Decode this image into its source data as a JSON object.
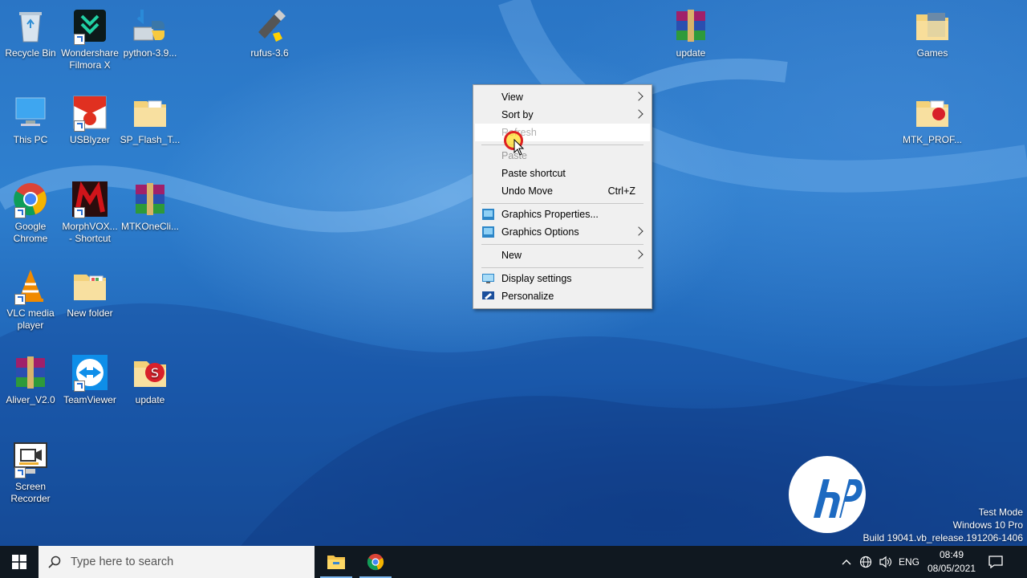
{
  "desktop_icons": [
    {
      "id": "recycle-bin",
      "label": "Recycle Bin"
    },
    {
      "id": "filmora",
      "label": "Wondershare Filmora X"
    },
    {
      "id": "python",
      "label": "python-3.9..."
    },
    {
      "id": "rufus",
      "label": "rufus-3.6"
    },
    {
      "id": "update-rar",
      "label": "update"
    },
    {
      "id": "games",
      "label": "Games"
    },
    {
      "id": "this-pc",
      "label": "This PC"
    },
    {
      "id": "usblyzer",
      "label": "USBlyzer"
    },
    {
      "id": "sp-flash",
      "label": "SP_Flash_T..."
    },
    {
      "id": "mtk-prof",
      "label": "MTK_PROF..."
    },
    {
      "id": "chrome",
      "label": "Google Chrome"
    },
    {
      "id": "morphvox",
      "label": "MorphVOX... - Shortcut"
    },
    {
      "id": "mtkonecli",
      "label": "MTKOneCli..."
    },
    {
      "id": "vlc",
      "label": "VLC media player"
    },
    {
      "id": "new-folder",
      "label": "New folder"
    },
    {
      "id": "aliver",
      "label": "Aliver_V2.0"
    },
    {
      "id": "teamviewer",
      "label": "TeamViewer"
    },
    {
      "id": "update-file",
      "label": "update"
    },
    {
      "id": "screen-recorder",
      "label": "Screen Recorder"
    }
  ],
  "context_menu": {
    "view": "View",
    "sort_by": "Sort by",
    "refresh": "Refresh",
    "paste": "Paste",
    "paste_shortcut": "Paste shortcut",
    "undo_move": "Undo Move",
    "undo_shortcut": "Ctrl+Z",
    "graphics_properties": "Graphics Properties...",
    "graphics_options": "Graphics Options",
    "new": "New",
    "display_settings": "Display settings",
    "personalize": "Personalize"
  },
  "watermark": {
    "line1": "Test Mode",
    "line2": "Windows 10 Pro",
    "line3": "Build 19041.vb_release.191206-1406"
  },
  "taskbar": {
    "search_placeholder": "Type here to search",
    "language": "ENG",
    "time": "08:49",
    "date": "08/05/2021"
  },
  "colors": {
    "taskbar": "#101820",
    "menu_bg": "#f0f0f0",
    "accent": "#0078d7"
  }
}
